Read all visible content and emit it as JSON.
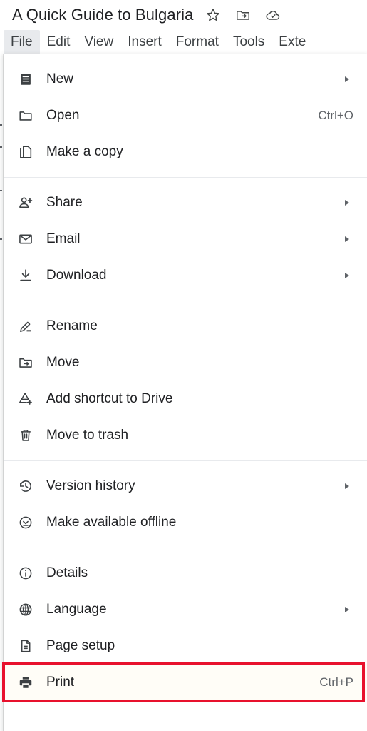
{
  "app": {
    "document_title": "A Quick Guide to Bulgaria",
    "title_icons": [
      {
        "name": "star-icon",
        "tooltip": "Star"
      },
      {
        "name": "move-to-folder-icon",
        "tooltip": "Move"
      },
      {
        "name": "cloud-saved-icon",
        "tooltip": "Saved to Drive"
      }
    ]
  },
  "menubar": {
    "items": [
      {
        "label": "File",
        "active": true
      },
      {
        "label": "Edit",
        "active": false
      },
      {
        "label": "View",
        "active": false
      },
      {
        "label": "Insert",
        "active": false
      },
      {
        "label": "Format",
        "active": false
      },
      {
        "label": "Tools",
        "active": false
      },
      {
        "label": "Exte",
        "active": false
      }
    ]
  },
  "file_menu": {
    "groups": [
      {
        "items": [
          {
            "label": "New",
            "icon": "new-document-icon",
            "shortcut": "",
            "submenu": true
          },
          {
            "label": "Open",
            "icon": "folder-icon",
            "shortcut": "Ctrl+O",
            "submenu": false
          },
          {
            "label": "Make a copy",
            "icon": "copy-icon",
            "shortcut": "",
            "submenu": false
          }
        ]
      },
      {
        "items": [
          {
            "label": "Share",
            "icon": "person-add-icon",
            "shortcut": "",
            "submenu": true
          },
          {
            "label": "Email",
            "icon": "envelope-icon",
            "shortcut": "",
            "submenu": true
          },
          {
            "label": "Download",
            "icon": "download-icon",
            "shortcut": "",
            "submenu": true
          }
        ]
      },
      {
        "items": [
          {
            "label": "Rename",
            "icon": "pencil-icon",
            "shortcut": "",
            "submenu": false
          },
          {
            "label": "Move",
            "icon": "move-to-folder-icon",
            "shortcut": "",
            "submenu": false
          },
          {
            "label": "Add shortcut to Drive",
            "icon": "drive-shortcut-add-icon",
            "shortcut": "",
            "submenu": false
          },
          {
            "label": "Move to trash",
            "icon": "trash-icon",
            "shortcut": "",
            "submenu": false
          }
        ]
      },
      {
        "items": [
          {
            "label": "Version history",
            "icon": "history-clock-icon",
            "shortcut": "",
            "submenu": true
          },
          {
            "label": "Make available offline",
            "icon": "offline-check-icon",
            "shortcut": "",
            "submenu": false
          }
        ]
      },
      {
        "items": [
          {
            "label": "Details",
            "icon": "info-circle-icon",
            "shortcut": "",
            "submenu": false
          },
          {
            "label": "Language",
            "icon": "globe-icon",
            "shortcut": "",
            "submenu": true
          },
          {
            "label": "Page setup",
            "icon": "page-setup-icon",
            "shortcut": "",
            "submenu": false
          },
          {
            "label": "Print",
            "icon": "printer-icon",
            "shortcut": "Ctrl+P",
            "submenu": false,
            "highlighted": true
          }
        ]
      }
    ]
  },
  "colors": {
    "highlight_border": "#e8112d",
    "menu_text": "#202124",
    "shortcut_text": "#5f6368",
    "active_tab_bg": "#e8eaed"
  }
}
